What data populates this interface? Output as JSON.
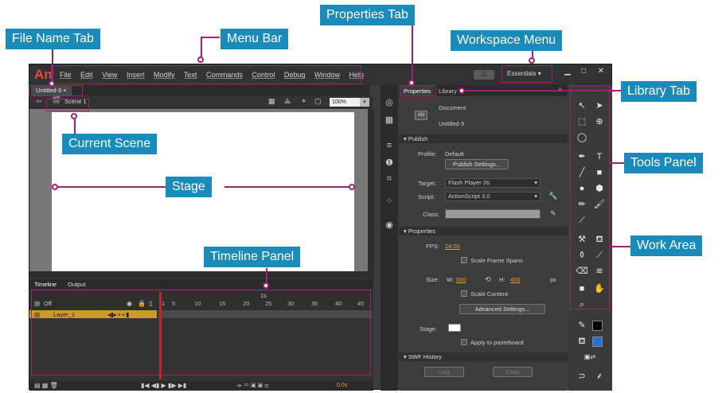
{
  "app": {
    "logo": "An",
    "menu": [
      "File",
      "Edit",
      "View",
      "Insert",
      "Modify",
      "Text",
      "Commands",
      "Control",
      "Debug",
      "Window",
      "Help"
    ],
    "workspace": "Essentials",
    "workspace_btn": "◫",
    "doc_tab": "Untitled-3",
    "doc_tab_close": "×",
    "scene": "Scene 1",
    "zoom": "100%"
  },
  "timeline": {
    "tabs": [
      "Timeline",
      "Output"
    ],
    "off_label": "Off",
    "layer": "Layer_1",
    "seconds_label": "1s",
    "frame_numbers": [
      "1",
      "5",
      "10",
      "15",
      "20",
      "25",
      "30",
      "35",
      "40",
      "45"
    ],
    "fps_bottom": "0.0s"
  },
  "properties": {
    "tabs": [
      "Properties",
      "Library"
    ],
    "doc_type": "Document",
    "doc_name": "Untitled-3",
    "doc_icon": "AN",
    "publish_header": "Publish",
    "profile_label": "Profile:",
    "profile_value": "Default",
    "publish_settings": "Publish Settings...",
    "target_label": "Target:",
    "target_value": "Flash Player 26",
    "script_label": "Script:",
    "script_value": "ActionScript 3.0",
    "class_label": "Class:",
    "properties_header": "Properties",
    "fps_label": "FPS:",
    "fps_value": "24.00",
    "scale_frame_spans": "Scale Frame Spans",
    "size_label": "Size:",
    "w_label": "W:",
    "w_value": "550",
    "h_label": "H:",
    "h_value": "400",
    "px": "px",
    "scale_content": "Scale Content",
    "advanced_settings": "Advanced Settings...",
    "stage_label": "Stage:",
    "apply_pasteboard": "Apply to pasteboard",
    "swf_header": "SWF History",
    "log_btn": "Log",
    "clear_btn": "Clear"
  },
  "callouts": {
    "file_name_tab": "File Name Tab",
    "menu_bar": "Menu Bar",
    "properties_tab": "Properties Tab",
    "workspace_menu": "Workspace Menu",
    "library_tab": "Library Tab",
    "current_scene": "Current Scene",
    "tools_panel": "Tools Panel",
    "stage": "Stage",
    "work_area": "Work Area",
    "timeline_panel": "Timeline Panel"
  },
  "colors": {
    "callout_bg": "#1a8ab8",
    "leader": "#a0216f",
    "logo": "#e34a3a",
    "layer_highlight": "#c79a2a",
    "accent_value": "#e0a33a"
  }
}
